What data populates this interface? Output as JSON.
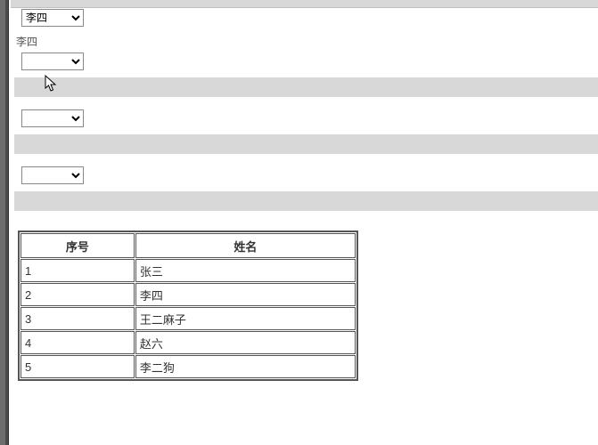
{
  "top_select": {
    "value": "李四"
  },
  "label_text": "李四",
  "empty_selects": [
    {
      "value": ""
    },
    {
      "value": ""
    },
    {
      "value": ""
    }
  ],
  "table": {
    "headers": {
      "id": "序号",
      "name": "姓名"
    },
    "rows": [
      {
        "id": "1",
        "name": "张三"
      },
      {
        "id": "2",
        "name": "李四"
      },
      {
        "id": "3",
        "name": "王二麻子"
      },
      {
        "id": "4",
        "name": "赵六"
      },
      {
        "id": "5",
        "name": "李二狗"
      }
    ]
  }
}
